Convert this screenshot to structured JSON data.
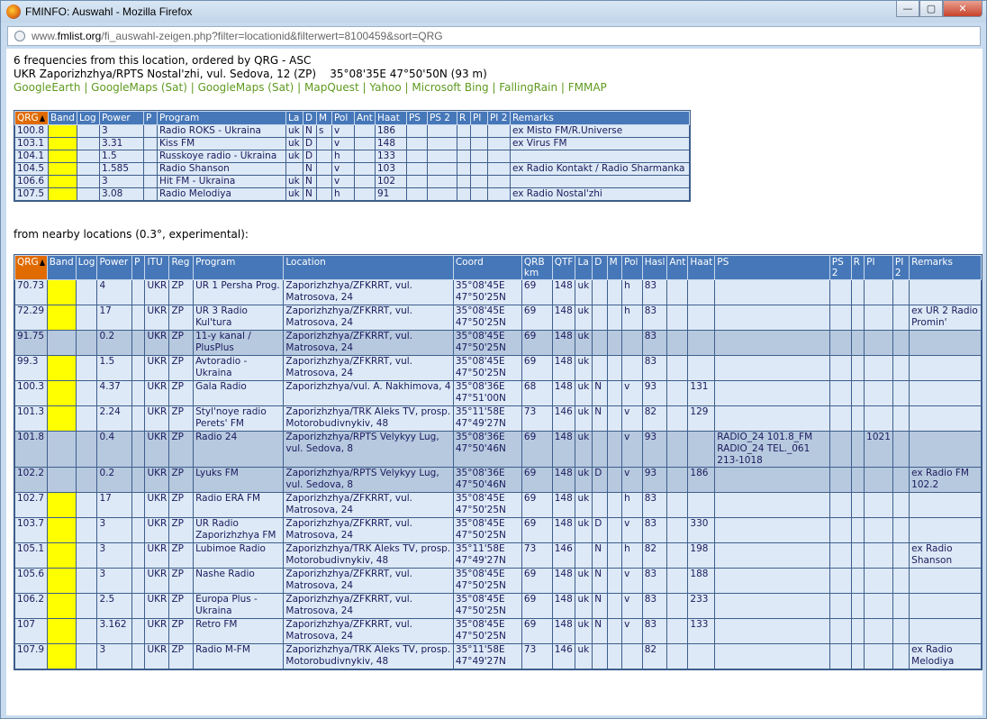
{
  "window": {
    "title": "FMINFO: Auswahl - Mozilla Firefox",
    "url_prefix": "www.",
    "url_domain": "fmlist.org",
    "url_path": "/fi_auswahl-zeigen.php?filter=locationid&filterwert=8100459&sort=QRG"
  },
  "header": {
    "line1": "6 frequencies from this location, ordered by QRG - ASC",
    "line2": "UKR Zaporizhzhya/RPTS Nostal'zhi, vul. Sedova, 12 (ZP)    35°08'35E 47°50'50N (93 m)",
    "links": [
      "GoogleEarth",
      "GoogleMaps (Sat)",
      "GoogleMaps (Sat)",
      "MapQuest",
      "Yahoo",
      "Microsoft Bing",
      "FallingRain",
      "FMMAP"
    ]
  },
  "colors": {
    "header_bg": "#4677b8",
    "qrg_bg": "#e06b00",
    "band_yellow": "#ffff00",
    "link_green": "#5f9a1f"
  },
  "table1": {
    "headers": [
      "QRG",
      "Band",
      "Log",
      "Power",
      "P",
      "Program",
      "La",
      "D",
      "M",
      "Pol",
      "Ant",
      "Haat",
      "PS",
      "PS 2",
      "R",
      "PI",
      "PI 2",
      "Remarks"
    ],
    "rows": [
      [
        "100.8",
        "",
        "",
        "3",
        "",
        "Radio ROKS - Ukraina",
        "uk",
        "N",
        "s",
        "v",
        "",
        "186",
        "",
        "",
        "",
        "",
        "",
        "ex Misto FM/R.Universe"
      ],
      [
        "103.1",
        "",
        "",
        "3.31",
        "",
        "Kiss FM",
        "uk",
        "D",
        "",
        "v",
        "",
        "148",
        "",
        "",
        "",
        "",
        "",
        "ex Virus FM"
      ],
      [
        "104.1",
        "",
        "",
        "1.5",
        "",
        "Russkoye radio - Ukraina",
        "uk",
        "D",
        "",
        "h",
        "",
        "133",
        "",
        "",
        "",
        "",
        "",
        ""
      ],
      [
        "104.5",
        "",
        "",
        "1.585",
        "",
        "Radio Shanson",
        "",
        "N",
        "",
        "v",
        "",
        "103",
        "",
        "",
        "",
        "",
        "",
        "ex Radio Kontakt / Radio Sharmanka"
      ],
      [
        "106.6",
        "",
        "",
        "3",
        "",
        "Hit FM - Ukraina",
        "uk",
        "N",
        "",
        "v",
        "",
        "102",
        "",
        "",
        "",
        "",
        "",
        ""
      ],
      [
        "107.5",
        "",
        "",
        "3.08",
        "",
        "Radio Melodiya",
        "uk",
        "N",
        "",
        "h",
        "",
        "91",
        "",
        "",
        "",
        "",
        "",
        "ex Radio Nostal'zhi"
      ]
    ]
  },
  "nearby_label": "from nearby locations (0.3°, experimental):",
  "table2": {
    "headers": [
      "QRG",
      "Band",
      "Log",
      "Power",
      "P",
      "ITU",
      "Reg",
      "Program",
      "Location",
      "Coord",
      "QRB km",
      "QTF",
      "La",
      "D",
      "M",
      "Pol",
      "Hasl",
      "Ant",
      "Haat",
      "PS",
      "PS 2",
      "R",
      "PI",
      "PI 2",
      "Remarks"
    ],
    "rows": [
      {
        "alt": false,
        "cells": [
          "70.73",
          "",
          "",
          "4",
          "",
          "UKR",
          "ZP",
          "UR 1 Persha Prog.",
          "Zaporizhzhya/ZFKRRT, vul. Matrosova, 24",
          "35°08'45E 47°50'25N",
          "69",
          "148",
          "uk",
          "",
          "",
          "h",
          "83",
          "",
          "",
          "",
          "",
          "",
          "",
          "",
          ""
        ]
      },
      {
        "alt": false,
        "cells": [
          "72.29",
          "",
          "",
          "17",
          "",
          "UKR",
          "ZP",
          "UR 3 Radio Kul'tura",
          "Zaporizhzhya/ZFKRRT, vul. Matrosova, 24",
          "35°08'45E 47°50'25N",
          "69",
          "148",
          "uk",
          "",
          "",
          "h",
          "83",
          "",
          "",
          "",
          "",
          "",
          "",
          "",
          "ex UR 2 Radio Promin'"
        ]
      },
      {
        "alt": true,
        "cells": [
          "91.75",
          "",
          "",
          "0.2",
          "",
          "UKR",
          "ZP",
          "11-y kanal / PlusPlus",
          "Zaporizhzhya/ZFKRRT, vul. Matrosova, 24",
          "35°08'45E 47°50'25N",
          "69",
          "148",
          "uk",
          "",
          "",
          "",
          "83",
          "",
          "",
          "",
          "",
          "",
          "",
          "",
          ""
        ]
      },
      {
        "alt": false,
        "cells": [
          "99.3",
          "",
          "",
          "1.5",
          "",
          "UKR",
          "ZP",
          "Avtoradio - Ukraina",
          "Zaporizhzhya/ZFKRRT, vul. Matrosova, 24",
          "35°08'45E 47°50'25N",
          "69",
          "148",
          "uk",
          "",
          "",
          "",
          "83",
          "",
          "",
          "",
          "",
          "",
          "",
          "",
          ""
        ]
      },
      {
        "alt": false,
        "cells": [
          "100.3",
          "",
          "",
          "4.37",
          "",
          "UKR",
          "ZP",
          "Gala Radio",
          "Zaporizhzhya/vul. A. Nakhimova, 4",
          "35°08'36E 47°51'00N",
          "68",
          "148",
          "uk",
          "N",
          "",
          "v",
          "93",
          "",
          "131",
          "",
          "",
          "",
          "",
          "",
          ""
        ]
      },
      {
        "alt": false,
        "cells": [
          "101.3",
          "",
          "",
          "2.24",
          "",
          "UKR",
          "ZP",
          "Styl'noye radio Perets' FM",
          "Zaporizhzhya/TRK Aleks TV, prosp. Motorobudivnykiv, 48",
          "35°11'58E 47°49'27N",
          "73",
          "146",
          "uk",
          "N",
          "",
          "v",
          "82",
          "",
          "129",
          "",
          "",
          "",
          "",
          "",
          ""
        ]
      },
      {
        "alt": true,
        "cells": [
          "101.8",
          "",
          "",
          "0.4",
          "",
          "UKR",
          "ZP",
          "Radio 24",
          "Zaporizhzhya/RPTS Velykyy Lug, vul. Sedova, 8",
          "35°08'36E 47°50'46N",
          "69",
          "148",
          "uk",
          "",
          "",
          "v",
          "93",
          "",
          "",
          "RADIO_24 101.8_FM RADIO_24 TEL._061 213-1018",
          "",
          "",
          "1021",
          "",
          ""
        ]
      },
      {
        "alt": true,
        "cells": [
          "102.2",
          "",
          "",
          "0.2",
          "",
          "UKR",
          "ZP",
          "Lyuks FM",
          "Zaporizhzhya/RPTS Velykyy Lug, vul. Sedova, 8",
          "35°08'36E 47°50'46N",
          "69",
          "148",
          "uk",
          "D",
          "",
          "v",
          "93",
          "",
          "186",
          "",
          "",
          "",
          "",
          "",
          "ex Radio FM 102.2"
        ]
      },
      {
        "alt": false,
        "cells": [
          "102.7",
          "",
          "",
          "17",
          "",
          "UKR",
          "ZP",
          "Radio ERA FM",
          "Zaporizhzhya/ZFKRRT, vul. Matrosova, 24",
          "35°08'45E 47°50'25N",
          "69",
          "148",
          "uk",
          "",
          "",
          "h",
          "83",
          "",
          "",
          "",
          "",
          "",
          "",
          "",
          ""
        ]
      },
      {
        "alt": false,
        "cells": [
          "103.7",
          "",
          "",
          "3",
          "",
          "UKR",
          "ZP",
          "UR Radio Zaporizhzhya FM",
          "Zaporizhzhya/ZFKRRT, vul. Matrosova, 24",
          "35°08'45E 47°50'25N",
          "69",
          "148",
          "uk",
          "D",
          "",
          "v",
          "83",
          "",
          "330",
          "",
          "",
          "",
          "",
          "",
          ""
        ]
      },
      {
        "alt": false,
        "cells": [
          "105.1",
          "",
          "",
          "3",
          "",
          "UKR",
          "ZP",
          "Lubimoe Radio",
          "Zaporizhzhya/TRK Aleks TV, prosp. Motorobudivnykiv, 48",
          "35°11'58E 47°49'27N",
          "73",
          "146",
          "",
          "N",
          "",
          "h",
          "82",
          "",
          "198",
          "",
          "",
          "",
          "",
          "",
          "ex Radio Shanson"
        ]
      },
      {
        "alt": false,
        "cells": [
          "105.6",
          "",
          "",
          "3",
          "",
          "UKR",
          "ZP",
          "Nashe Radio",
          "Zaporizhzhya/ZFKRRT, vul. Matrosova, 24",
          "35°08'45E 47°50'25N",
          "69",
          "148",
          "uk",
          "N",
          "",
          "v",
          "83",
          "",
          "188",
          "",
          "",
          "",
          "",
          "",
          ""
        ]
      },
      {
        "alt": false,
        "cells": [
          "106.2",
          "",
          "",
          "2.5",
          "",
          "UKR",
          "ZP",
          "Europa Plus - Ukraina",
          "Zaporizhzhya/ZFKRRT, vul. Matrosova, 24",
          "35°08'45E 47°50'25N",
          "69",
          "148",
          "uk",
          "N",
          "",
          "v",
          "83",
          "",
          "233",
          "",
          "",
          "",
          "",
          "",
          ""
        ]
      },
      {
        "alt": false,
        "cells": [
          "107",
          "",
          "",
          "3.162",
          "",
          "UKR",
          "ZP",
          "Retro FM",
          "Zaporizhzhya/ZFKRRT, vul. Matrosova, 24",
          "35°08'45E 47°50'25N",
          "69",
          "148",
          "uk",
          "N",
          "",
          "v",
          "83",
          "",
          "133",
          "",
          "",
          "",
          "",
          "",
          ""
        ]
      },
      {
        "alt": false,
        "cells": [
          "107.9",
          "",
          "",
          "3",
          "",
          "UKR",
          "ZP",
          "Radio M-FM",
          "Zaporizhzhya/TRK Aleks TV, prosp. Motorobudivnykiv, 48",
          "35°11'58E 47°49'27N",
          "73",
          "146",
          "uk",
          "",
          "",
          "",
          "82",
          "",
          "",
          "",
          "",
          "",
          "",
          "",
          "ex Radio Melodiya"
        ]
      }
    ]
  }
}
